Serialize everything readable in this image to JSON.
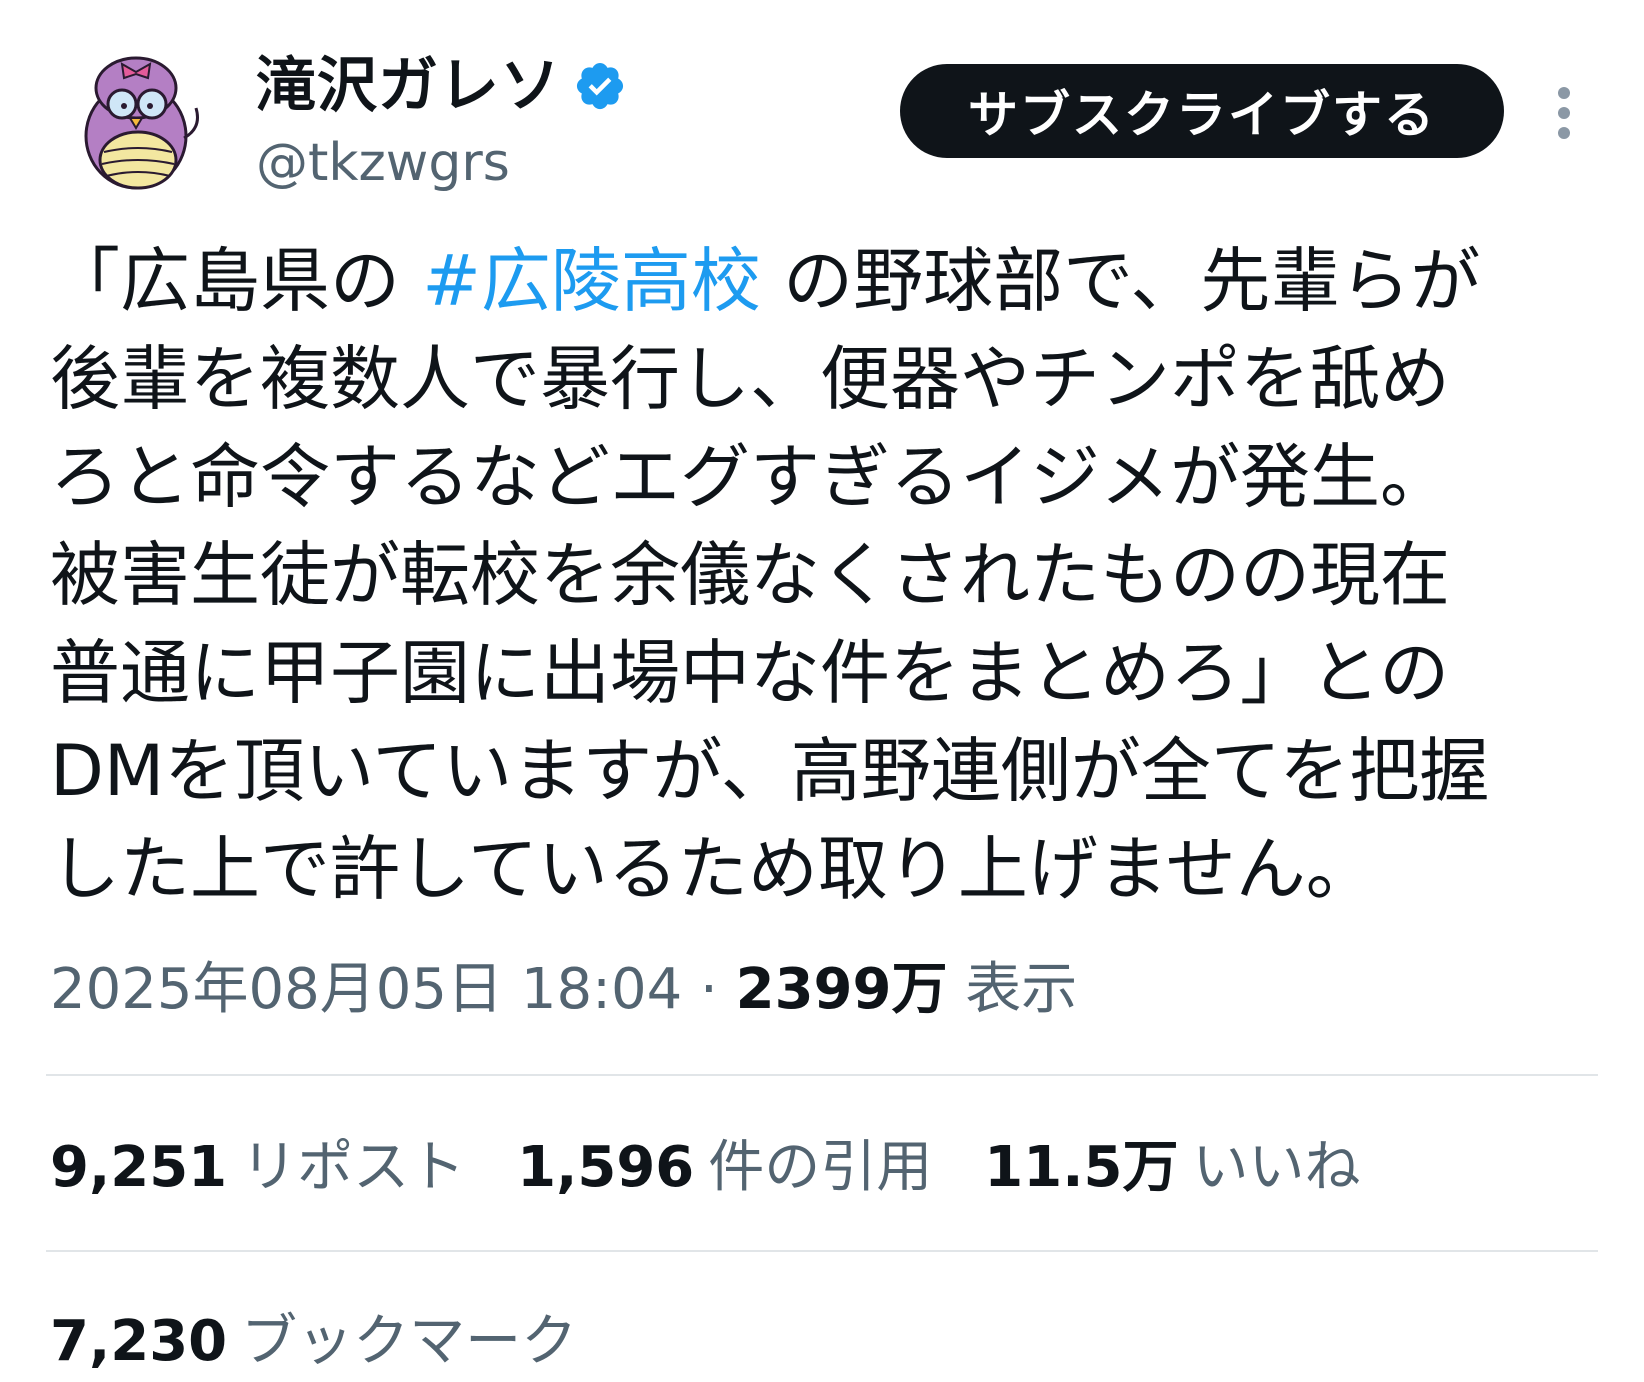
{
  "author": {
    "display_name": "滝沢ガレソ",
    "handle": "@tkzwgrs",
    "verified": true
  },
  "actions": {
    "subscribe_label": "サブスクライブする"
  },
  "tweet": {
    "lines": [
      {
        "before": "「広島県の ",
        "hashtag": "#広陵高校",
        "after": " の野球部で、先輩らが"
      },
      {
        "text": "後輩を複数人で暴行し、便器やチンポを舐め"
      },
      {
        "text": "ろと命令するなどエグすぎるイジメが発生。"
      },
      {
        "text": "被害生徒が転校を余儀なくされたものの現在"
      },
      {
        "text": "普通に甲子園に出場中な件をまとめろ」との"
      },
      {
        "text": "DMを頂いていますが、高野連側が全てを把握"
      },
      {
        "text": "した上で許しているため取り上げません。"
      }
    ]
  },
  "meta": {
    "timestamp": "2025年08月05日 18:04",
    "separator": " · ",
    "views_count": "2399万",
    "views_label": " 表示"
  },
  "stats": {
    "reposts": {
      "count": "9,251",
      "label": "リポスト"
    },
    "quotes": {
      "count": "1,596",
      "label": "件の引用"
    },
    "likes": {
      "count": "11.5万",
      "label": "いいね"
    },
    "bookmarks": {
      "count": "7,230",
      "label": "ブックマーク"
    }
  },
  "colors": {
    "accent": "#1d9bf0",
    "text_primary": "#0f1419",
    "text_secondary": "#536471",
    "divider": "#e1e5e8"
  },
  "icons": {
    "verified": "verified-badge-icon",
    "more": "more-vertical-icon"
  }
}
